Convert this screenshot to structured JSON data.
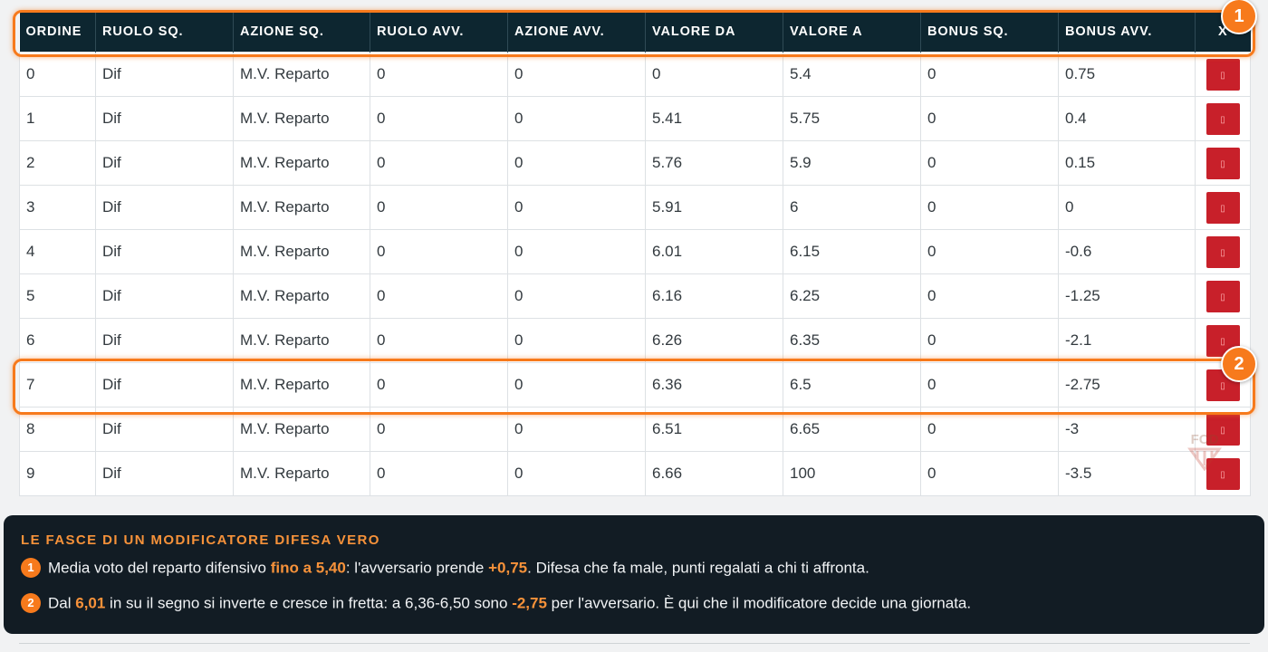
{
  "table": {
    "headers": [
      "ORDINE",
      "RUOLO SQ.",
      "AZIONE SQ.",
      "RUOLO AVV.",
      "AZIONE AVV.",
      "VALORE DA",
      "VALORE A",
      "BONUS SQ.",
      "BONUS AVV.",
      "X"
    ],
    "rows": [
      {
        "ordine": "0",
        "ruolo_sq": "Dif",
        "azione_sq": "M.V. Reparto",
        "ruolo_avv": "0",
        "azione_avv": "0",
        "valore_da": "0",
        "valore_a": "5.4",
        "bonus_sq": "0",
        "bonus_avv": "0.75"
      },
      {
        "ordine": "1",
        "ruolo_sq": "Dif",
        "azione_sq": "M.V. Reparto",
        "ruolo_avv": "0",
        "azione_avv": "0",
        "valore_da": "5.41",
        "valore_a": "5.75",
        "bonus_sq": "0",
        "bonus_avv": "0.4"
      },
      {
        "ordine": "2",
        "ruolo_sq": "Dif",
        "azione_sq": "M.V. Reparto",
        "ruolo_avv": "0",
        "azione_avv": "0",
        "valore_da": "5.76",
        "valore_a": "5.9",
        "bonus_sq": "0",
        "bonus_avv": "0.15"
      },
      {
        "ordine": "3",
        "ruolo_sq": "Dif",
        "azione_sq": "M.V. Reparto",
        "ruolo_avv": "0",
        "azione_avv": "0",
        "valore_da": "5.91",
        "valore_a": "6",
        "bonus_sq": "0",
        "bonus_avv": "0"
      },
      {
        "ordine": "4",
        "ruolo_sq": "Dif",
        "azione_sq": "M.V. Reparto",
        "ruolo_avv": "0",
        "azione_avv": "0",
        "valore_da": "6.01",
        "valore_a": "6.15",
        "bonus_sq": "0",
        "bonus_avv": "-0.6"
      },
      {
        "ordine": "5",
        "ruolo_sq": "Dif",
        "azione_sq": "M.V. Reparto",
        "ruolo_avv": "0",
        "azione_avv": "0",
        "valore_da": "6.16",
        "valore_a": "6.25",
        "bonus_sq": "0",
        "bonus_avv": "-1.25"
      },
      {
        "ordine": "6",
        "ruolo_sq": "Dif",
        "azione_sq": "M.V. Reparto",
        "ruolo_avv": "0",
        "azione_avv": "0",
        "valore_da": "6.26",
        "valore_a": "6.35",
        "bonus_sq": "0",
        "bonus_avv": "-2.1"
      },
      {
        "ordine": "7",
        "ruolo_sq": "Dif",
        "azione_sq": "M.V. Reparto",
        "ruolo_avv": "0",
        "azione_avv": "0",
        "valore_da": "6.36",
        "valore_a": "6.5",
        "bonus_sq": "0",
        "bonus_avv": "-2.75"
      },
      {
        "ordine": "8",
        "ruolo_sq": "Dif",
        "azione_sq": "M.V. Reparto",
        "ruolo_avv": "0",
        "azione_avv": "0",
        "valore_da": "6.51",
        "valore_a": "6.65",
        "bonus_sq": "0",
        "bonus_avv": "-3"
      },
      {
        "ordine": "9",
        "ruolo_sq": "Dif",
        "azione_sq": "M.V. Reparto",
        "ruolo_avv": "0",
        "azione_avv": "0",
        "valore_da": "6.66",
        "valore_a": "100",
        "bonus_sq": "0",
        "bonus_avv": "-3.5"
      }
    ],
    "delete_icon": "trash-icon"
  },
  "badges": {
    "header": "1",
    "row": "2"
  },
  "highlighted_row_index": 7,
  "watermark_text": "FCD",
  "panel": {
    "title": "LE FASCE DI UN MODIFICATORE DIFESA VERO",
    "line1": {
      "num": "1",
      "t1": "Media voto del reparto difensivo ",
      "h1": "fino a 5,40",
      "t2": ": l'avversario prende ",
      "h2": "+0,75",
      "t3": ". Difesa che fa male, punti regalati a chi ti affronta."
    },
    "line2": {
      "num": "2",
      "t1": "Dal ",
      "h1": "6,01",
      "t2": " in su il segno si inverte e cresce in fretta: a 6,36-6,50 sono ",
      "h2": "-2,75",
      "t3": " per l'avversario. È qui che il modificatore decide una giornata."
    }
  },
  "colors": {
    "accent": "#f77a1c",
    "header_bg": "#0d2630",
    "panel_bg": "#121c24",
    "delete_button": "#c8202a"
  }
}
